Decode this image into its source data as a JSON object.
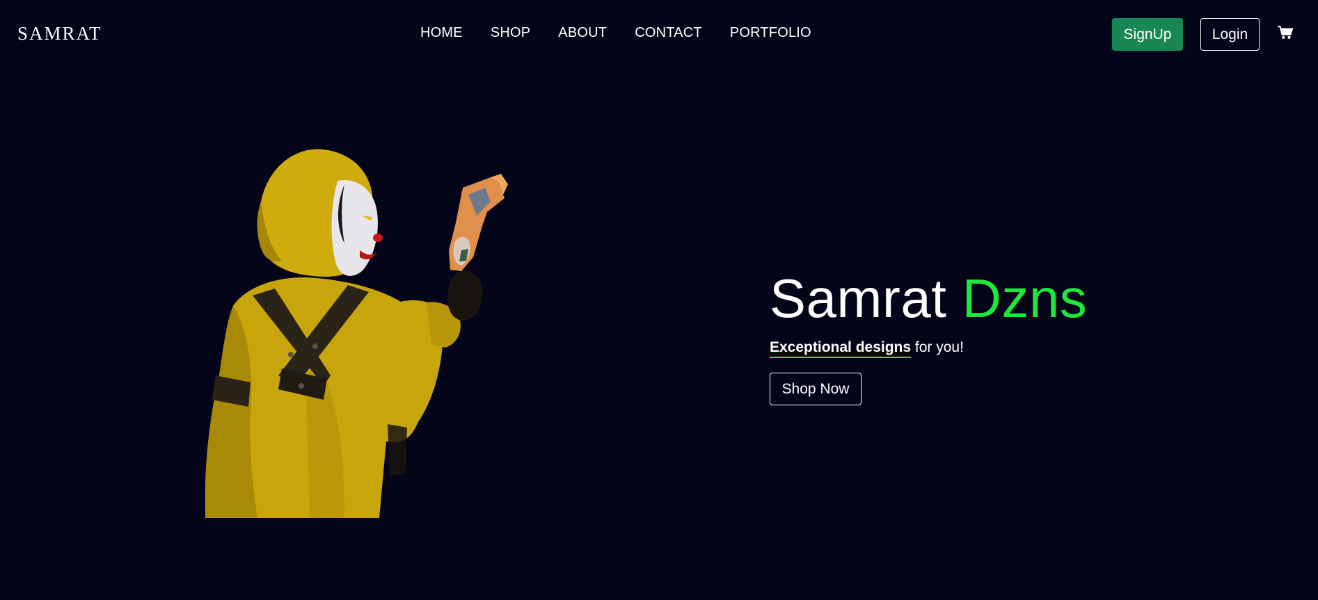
{
  "header": {
    "brand": "SAMRAT",
    "nav": [
      {
        "label": "HOME"
      },
      {
        "label": "SHOP"
      },
      {
        "label": "ABOUT"
      },
      {
        "label": "CONTACT"
      },
      {
        "label": "PORTFOLIO"
      }
    ],
    "signup_label": "SignUp",
    "login_label": "Login",
    "cart_icon": "cart-icon"
  },
  "hero": {
    "title_main": "Samrat",
    "title_accent": "Dzns",
    "tagline_emphasis": "Exceptional designs",
    "tagline_rest": "for you!",
    "shop_label": "Shop Now",
    "figure_icon": "hooded-clown-character-with-gun"
  },
  "colors": {
    "background": "#05051a",
    "accent_green": "#1ee83b",
    "signup_green": "#198754",
    "figure_yellow": "#d4b20c"
  }
}
